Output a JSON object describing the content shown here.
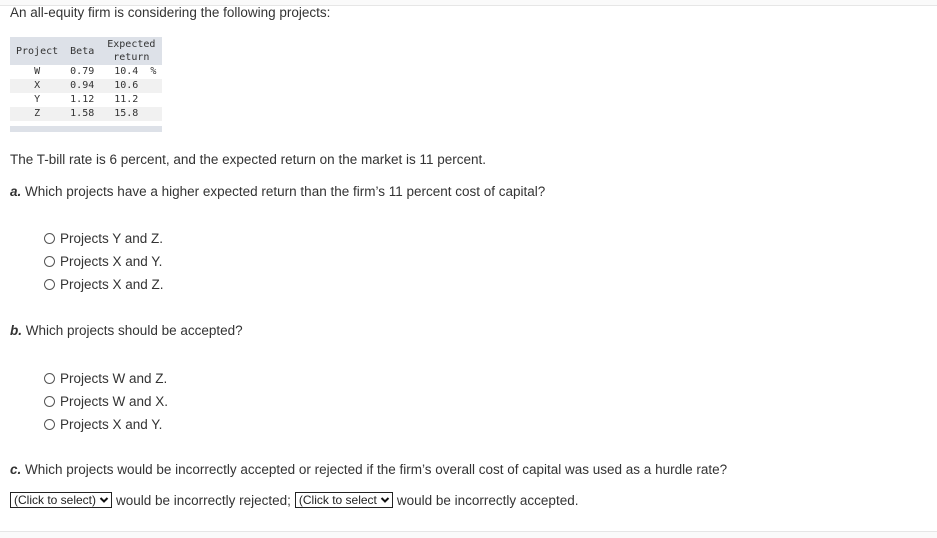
{
  "intro": "An all-equity firm is considering the following projects:",
  "table": {
    "headers": [
      "Project",
      "Beta",
      "Expected return"
    ],
    "header_lines": {
      "expected1": "Expected",
      "expected2": "return"
    },
    "rows": [
      {
        "project": "W",
        "beta": "0.79",
        "expected_return": "10.4",
        "unit": "%"
      },
      {
        "project": "X",
        "beta": "0.94",
        "expected_return": "10.6",
        "unit": ""
      },
      {
        "project": "Y",
        "beta": "1.12",
        "expected_return": "11.2",
        "unit": ""
      },
      {
        "project": "Z",
        "beta": "1.58",
        "expected_return": "15.8",
        "unit": ""
      }
    ]
  },
  "statement": "The T-bill rate is 6 percent, and the expected return on the market is 11 percent.",
  "question_a": {
    "label": "a.",
    "text": "Which projects have a higher expected return than the firm’s 11 percent cost of capital?",
    "options": [
      "Projects Y and Z.",
      "Projects X and Y.",
      "Projects X and Z."
    ]
  },
  "question_b": {
    "label": "b.",
    "text": "Which projects should be accepted?",
    "options": [
      "Projects W and Z.",
      "Projects W and X.",
      "Projects X and Y."
    ]
  },
  "question_c": {
    "label": "c.",
    "text": "Which projects would be incorrectly accepted or rejected if the firm’s overall cost of capital was used as a hurdle rate?",
    "select1_value": "(Click to select)",
    "text1": "would be incorrectly rejected;",
    "select2_value": "(Click to select)",
    "text2": "would be incorrectly accepted."
  }
}
